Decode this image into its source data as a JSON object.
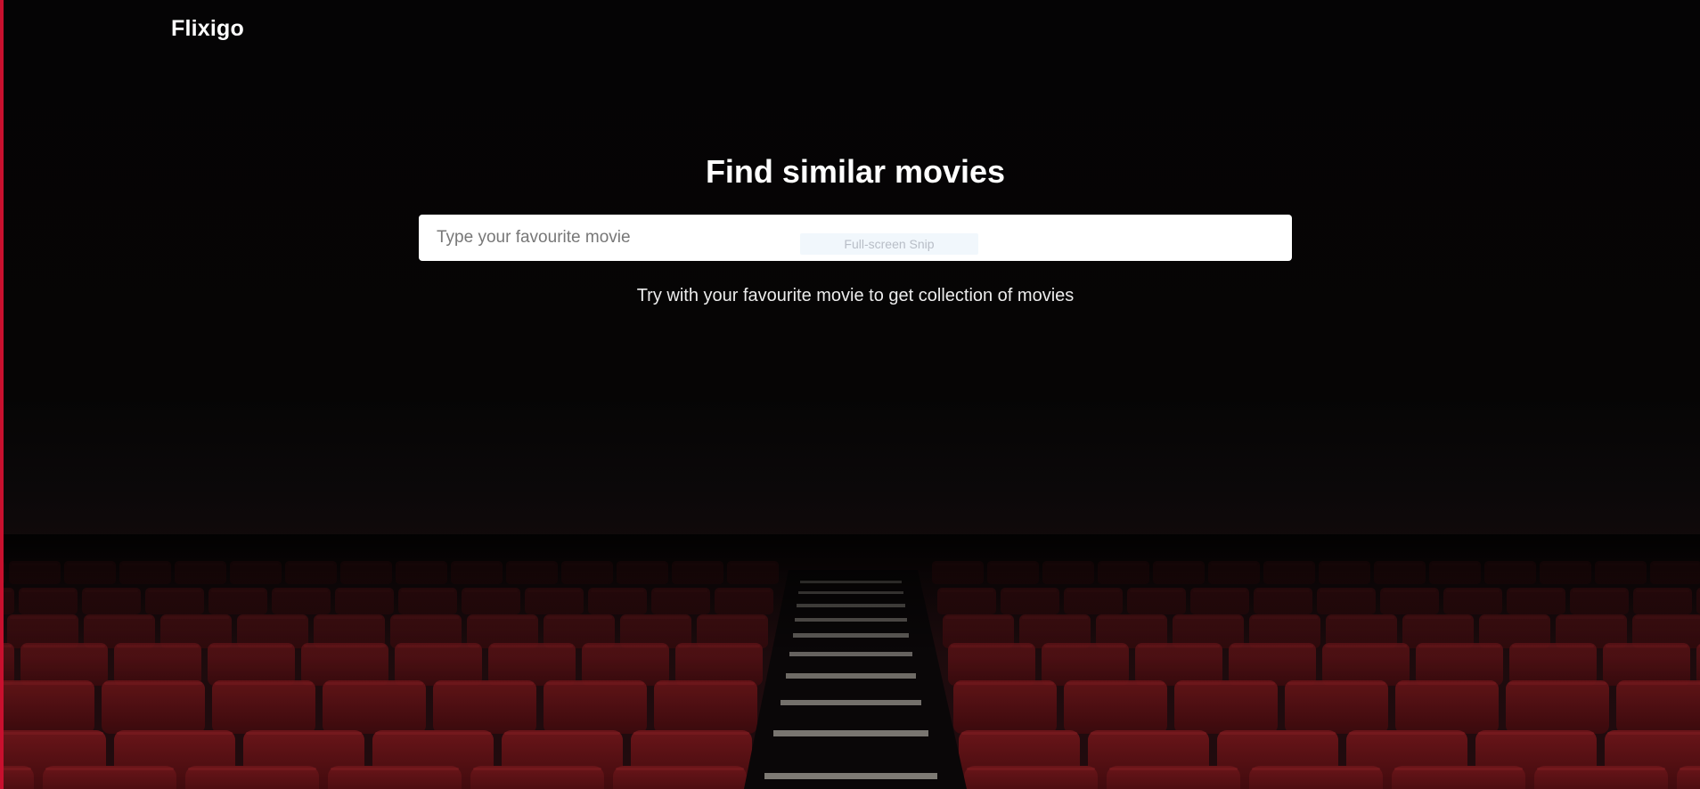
{
  "brand": {
    "name": "Flixigo"
  },
  "hero": {
    "title": "Find similar movies",
    "search_placeholder": "Type your favourite movie",
    "search_value": "",
    "hint": "Try with your favourite movie to get collection of movies"
  },
  "overlay": {
    "label": "Full-screen Snip"
  },
  "colors": {
    "accent": "#c8102e",
    "background": "#050405",
    "seat": "#5a1116"
  }
}
